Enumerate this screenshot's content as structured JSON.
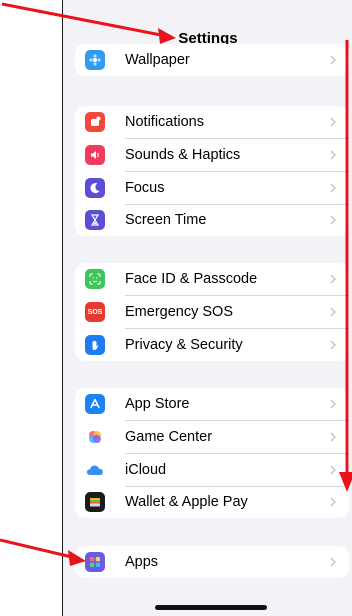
{
  "header": {
    "title": "Settings"
  },
  "groups": [
    {
      "items": [
        {
          "label": "Wallpaper",
          "icon": "wallpaper-icon",
          "color": "#2f9bf3"
        }
      ]
    },
    {
      "items": [
        {
          "label": "Notifications",
          "icon": "notifications-icon",
          "color": "#f2473a"
        },
        {
          "label": "Sounds & Haptics",
          "icon": "sounds-icon",
          "color": "#f23b5c"
        },
        {
          "label": "Focus",
          "icon": "focus-moon-icon",
          "color": "#5b4fd7"
        },
        {
          "label": "Screen Time",
          "icon": "hourglass-icon",
          "color": "#5b4fd7"
        }
      ]
    },
    {
      "items": [
        {
          "label": "Face ID & Passcode",
          "icon": "faceid-icon",
          "color": "#3bc55a"
        },
        {
          "label": "Emergency SOS",
          "icon": "sos-icon",
          "color": "#e8392e",
          "icon_text": "SOS"
        },
        {
          "label": "Privacy & Security",
          "icon": "hand-icon",
          "color": "#1d7cf2"
        }
      ]
    },
    {
      "items": [
        {
          "label": "App Store",
          "icon": "app-store-icon",
          "color": "#1d82f5"
        },
        {
          "label": "Game Center",
          "icon": "game-center-icon",
          "color": "#ffffff"
        },
        {
          "label": "iCloud",
          "icon": "icloud-icon",
          "color": "#ffffff"
        },
        {
          "label": "Wallet & Apple Pay",
          "icon": "wallet-icon",
          "color": "#1c1c1e"
        }
      ]
    },
    {
      "items": [
        {
          "label": "Apps",
          "icon": "apps-grid-icon",
          "color": "#6a5be0"
        }
      ]
    }
  ],
  "annotation_color": "#e8141b"
}
